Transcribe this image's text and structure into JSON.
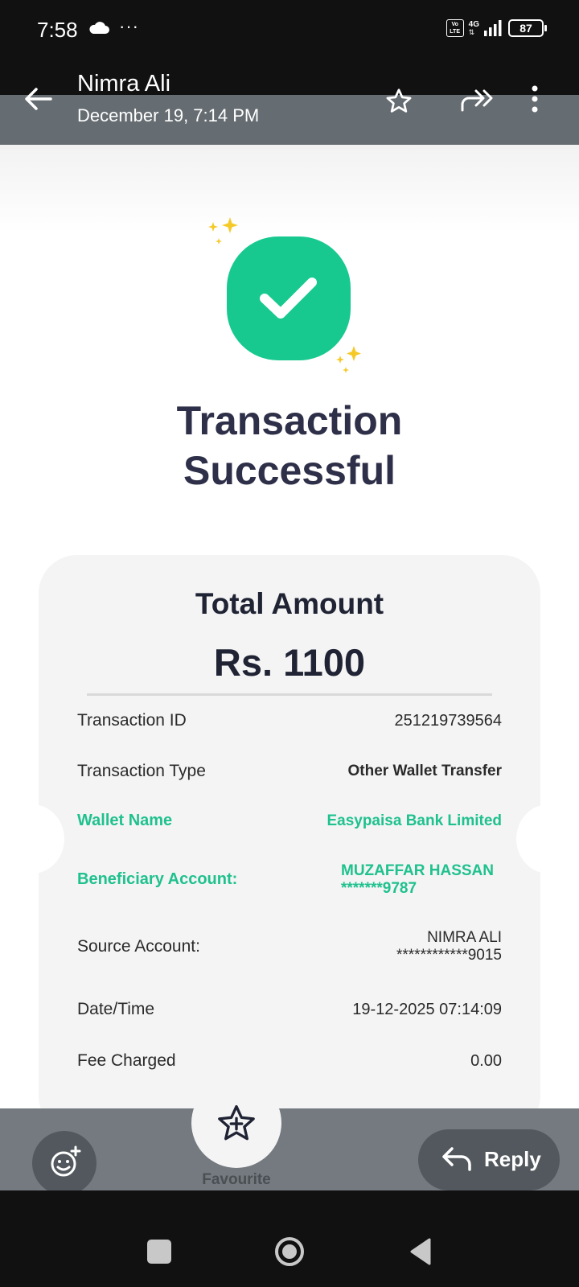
{
  "status_bar": {
    "time": "7:58",
    "dots": "···",
    "network": "4G",
    "volte": "Vo LTE",
    "battery": "87"
  },
  "header": {
    "sender": "Nimra Ali",
    "date": "December 19, 7:14 PM"
  },
  "receipt": {
    "title_line1": "Transaction",
    "title_line2": "Successful",
    "total_label": "Total Amount",
    "total_amount": "Rs. 1100",
    "rows": [
      {
        "label": "Transaction ID",
        "value": "251219739564"
      },
      {
        "label": "Transaction Type",
        "value": "Other Wallet Transfer"
      },
      {
        "label": "Wallet Name",
        "value": "Easypaisa Bank Limited"
      },
      {
        "label": "Beneficiary Account:",
        "value_line1": "MUZAFFAR HASSAN",
        "value_line2": "*******9787"
      },
      {
        "label": "Source Account:",
        "value_line1": "NIMRA ALI",
        "value_line2": "************9015"
      },
      {
        "label": "Date/Time",
        "value": "19-12-2025 07:14:09"
      },
      {
        "label": "Fee Charged",
        "value": "0.00"
      }
    ],
    "accent_color": "#17c98f",
    "text_color": "#2e2f48"
  },
  "actions": {
    "favourite_label": "Favourite",
    "reply_label": "Reply"
  }
}
